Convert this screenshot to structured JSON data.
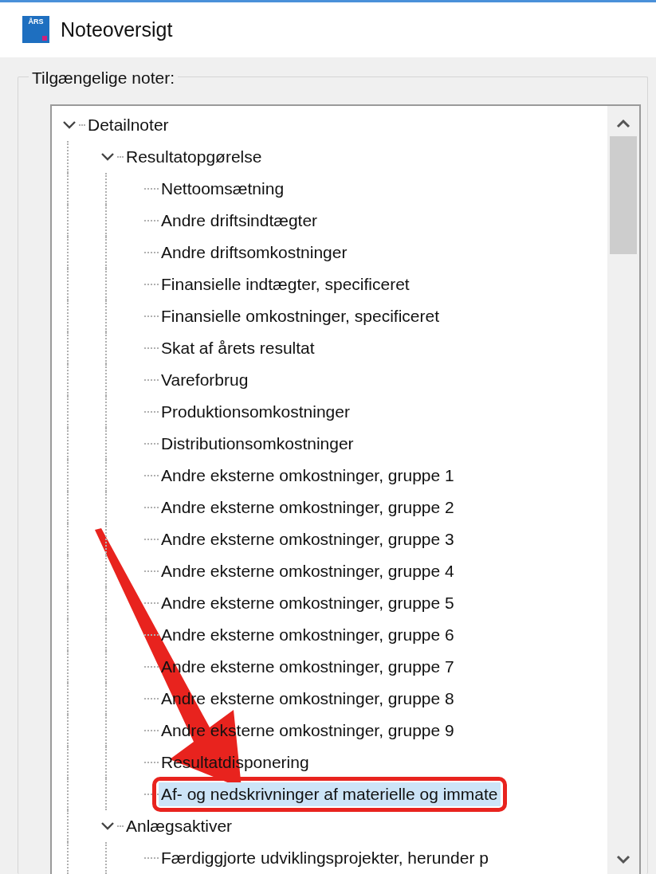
{
  "window": {
    "title": "Noteoversigt",
    "icon_text": "ÅRS"
  },
  "group": {
    "label": "Tilgængelige noter:"
  },
  "tree": [
    {
      "label": "Detailnoter",
      "expanded": true,
      "selected": false,
      "children": [
        {
          "label": "Resultatopgørelse",
          "expanded": true,
          "selected": false,
          "children": [
            {
              "label": "Nettoomsætning",
              "selected": false
            },
            {
              "label": "Andre driftsindtægter",
              "selected": false
            },
            {
              "label": "Andre driftsomkostninger",
              "selected": false
            },
            {
              "label": "Finansielle indtægter, specificeret",
              "selected": false
            },
            {
              "label": "Finansielle omkostninger, specificeret",
              "selected": false
            },
            {
              "label": "Skat af årets resultat",
              "selected": false
            },
            {
              "label": "Vareforbrug",
              "selected": false
            },
            {
              "label": "Produktionsomkostninger",
              "selected": false
            },
            {
              "label": "Distributionsomkostninger",
              "selected": false
            },
            {
              "label": "Andre eksterne omkostninger, gruppe 1",
              "selected": false
            },
            {
              "label": "Andre eksterne omkostninger, gruppe 2",
              "selected": false
            },
            {
              "label": "Andre eksterne omkostninger, gruppe 3",
              "selected": false
            },
            {
              "label": "Andre eksterne omkostninger, gruppe 4",
              "selected": false
            },
            {
              "label": "Andre eksterne omkostninger, gruppe 5",
              "selected": false
            },
            {
              "label": "Andre eksterne omkostninger, gruppe 6",
              "selected": false
            },
            {
              "label": "Andre eksterne omkostninger, gruppe 7",
              "selected": false
            },
            {
              "label": "Andre eksterne omkostninger, gruppe 8",
              "selected": false
            },
            {
              "label": "Andre eksterne omkostninger, gruppe 9",
              "selected": false
            },
            {
              "label": "Resultatdisponering",
              "selected": false
            },
            {
              "label": "Af- og nedskrivninger af materielle og immate",
              "selected": true
            }
          ]
        },
        {
          "label": "Anlægsaktiver",
          "expanded": true,
          "selected": false,
          "children": [
            {
              "label": "Færdiggjorte udviklingsprojekter, herunder p",
              "selected": false
            }
          ]
        }
      ]
    }
  ]
}
